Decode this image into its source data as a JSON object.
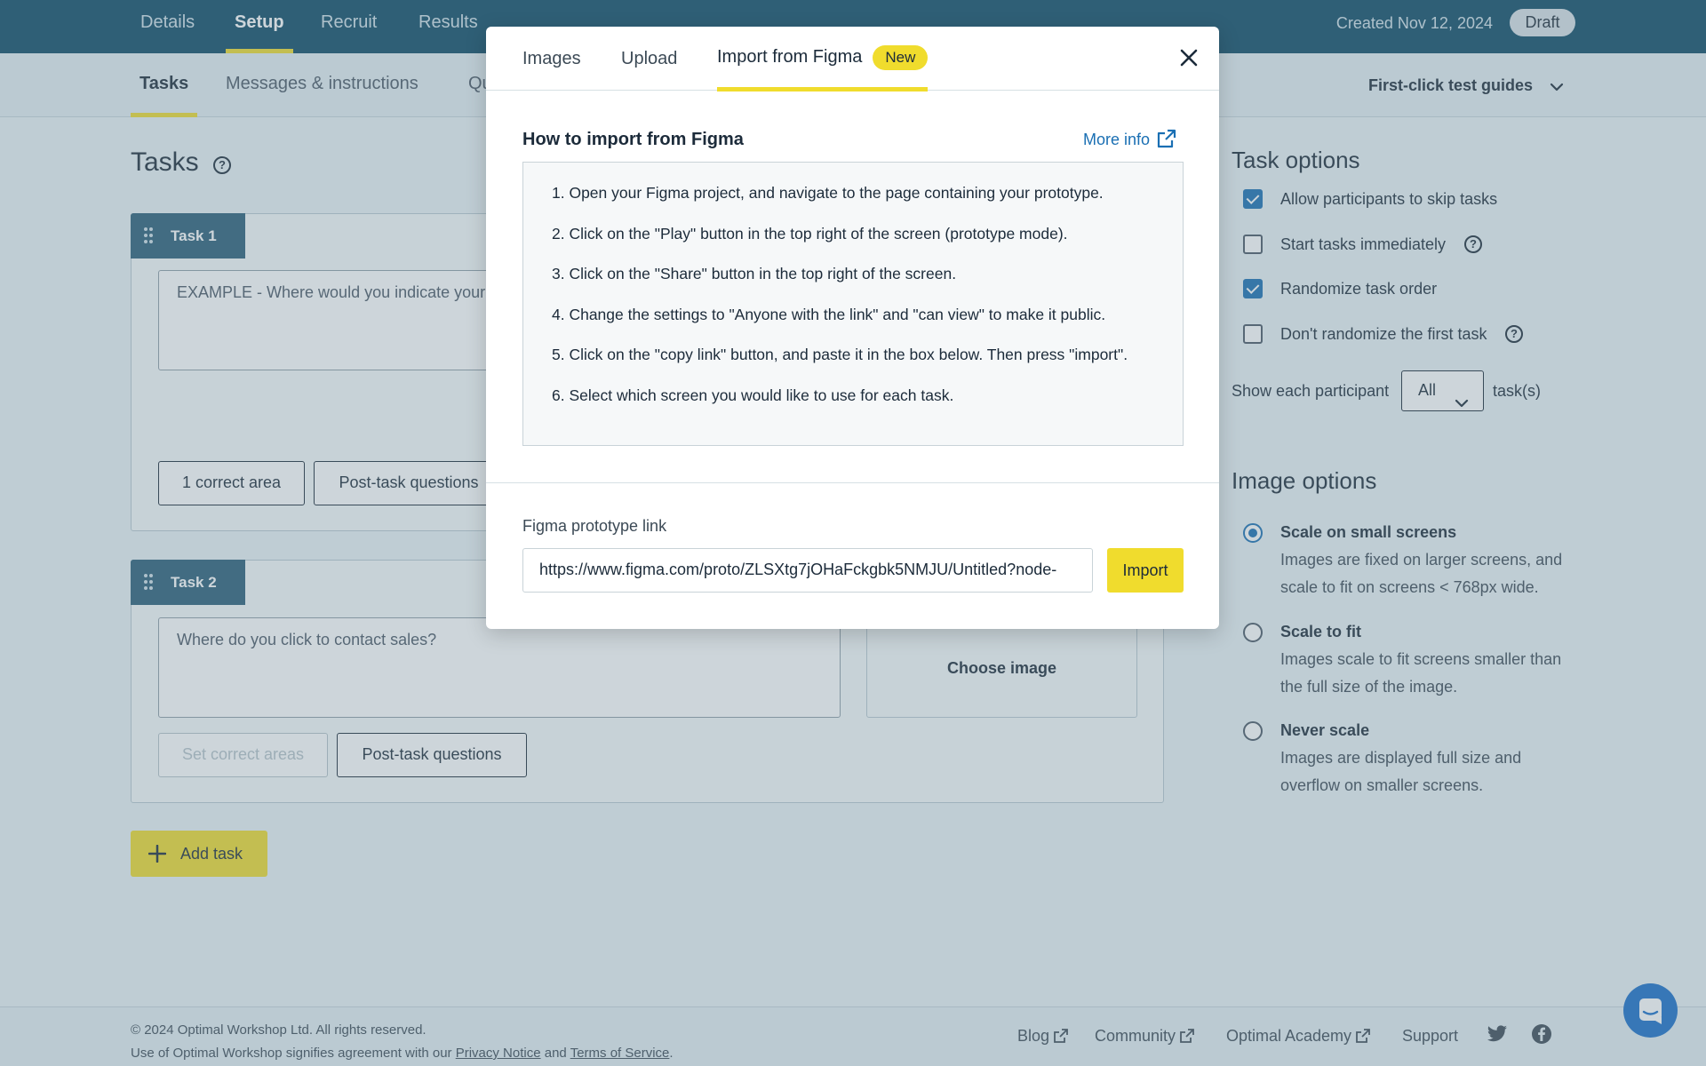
{
  "topnav": {
    "tabs": [
      {
        "label": "Details"
      },
      {
        "label": "Setup"
      },
      {
        "label": "Recruit"
      },
      {
        "label": "Results"
      }
    ],
    "created": "Created Nov 12, 2024",
    "status_badge": "Draft"
  },
  "subnav": {
    "tabs": [
      {
        "label": "Tasks"
      },
      {
        "label": "Messages & instructions"
      },
      {
        "label": "Qu"
      }
    ],
    "guides": "First-click test guides"
  },
  "tasks_page": {
    "title": "Tasks",
    "tasks": [
      {
        "tab_label": "Task 1",
        "text": "EXAMPLE - Where would you indicate your",
        "correct_area_label": "1 correct area",
        "post_task_label": "Post-task questions"
      },
      {
        "tab_label": "Task 2",
        "text": "Where do you click to contact sales?",
        "correct_area_label": "Set correct areas",
        "post_task_label": "Post-task questions",
        "choose_image_label": "Choose image"
      }
    ],
    "add_task_label": "Add task"
  },
  "task_options": {
    "heading": "Task options",
    "options": [
      {
        "label": "Allow participants to skip tasks",
        "checked": true
      },
      {
        "label": "Start tasks immediately",
        "checked": false
      },
      {
        "label": "Randomize task order",
        "checked": true
      },
      {
        "label": "Don't randomize the first task",
        "checked": false
      }
    ],
    "show_each_label": "Show each participant",
    "show_each_value": "All",
    "show_each_suffix": "task(s)"
  },
  "image_options": {
    "heading": "Image options",
    "options": [
      {
        "title": "Scale on small screens",
        "desc": "Images are fixed on larger screens, and scale to fit on screens < 768px wide.",
        "selected": true
      },
      {
        "title": "Scale to fit",
        "desc": "Images scale to fit screens smaller than the full size of the image.",
        "selected": false
      },
      {
        "title": "Never scale",
        "desc": "Images are displayed full size and overflow on smaller screens.",
        "selected": false
      }
    ]
  },
  "footer": {
    "copyright_line1": "© 2024 Optimal Workshop Ltd. All rights reserved.",
    "copyright_line2_pre": "Use of Optimal Workshop signifies agreement with our",
    "privacy_link": "Privacy Notice",
    "and": "and",
    "terms_link": "Terms of Service",
    "period": ".",
    "links": [
      {
        "label": "Blog"
      },
      {
        "label": "Community"
      },
      {
        "label": "Optimal Academy"
      },
      {
        "label": "Support"
      }
    ]
  },
  "modal": {
    "tabs": [
      {
        "label": "Images"
      },
      {
        "label": "Upload"
      },
      {
        "label": "Import from Figma"
      }
    ],
    "new_badge": "New",
    "how_title": "How to import from Figma",
    "more_info": "More info",
    "steps": [
      "1. Open your Figma project, and navigate to the page containing your prototype.",
      "2. Click on the \"Play\" button in the top right of the screen (prototype mode).",
      "3. Click on the \"Share\" button in the top right of the screen.",
      "4. Change the settings to \"Anyone with the link\" and \"can view\" to make it public.",
      "5. Click on the \"copy link\" button, and paste it in the box below. Then press \"import\".",
      "6. Select which screen you would like to use for each task."
    ],
    "link_label": "Figma prototype link",
    "link_value": "https://www.figma.com/proto/ZLSXtg7jOHaFckgbk5NMJU/Untitled?node-",
    "import_label": "Import"
  },
  "colors": {
    "nav_bg": "#0d4a66",
    "accent_yellow": "#f0dc2d",
    "link_blue": "#1a6fb3",
    "chat_blue": "#1a6fc9"
  }
}
